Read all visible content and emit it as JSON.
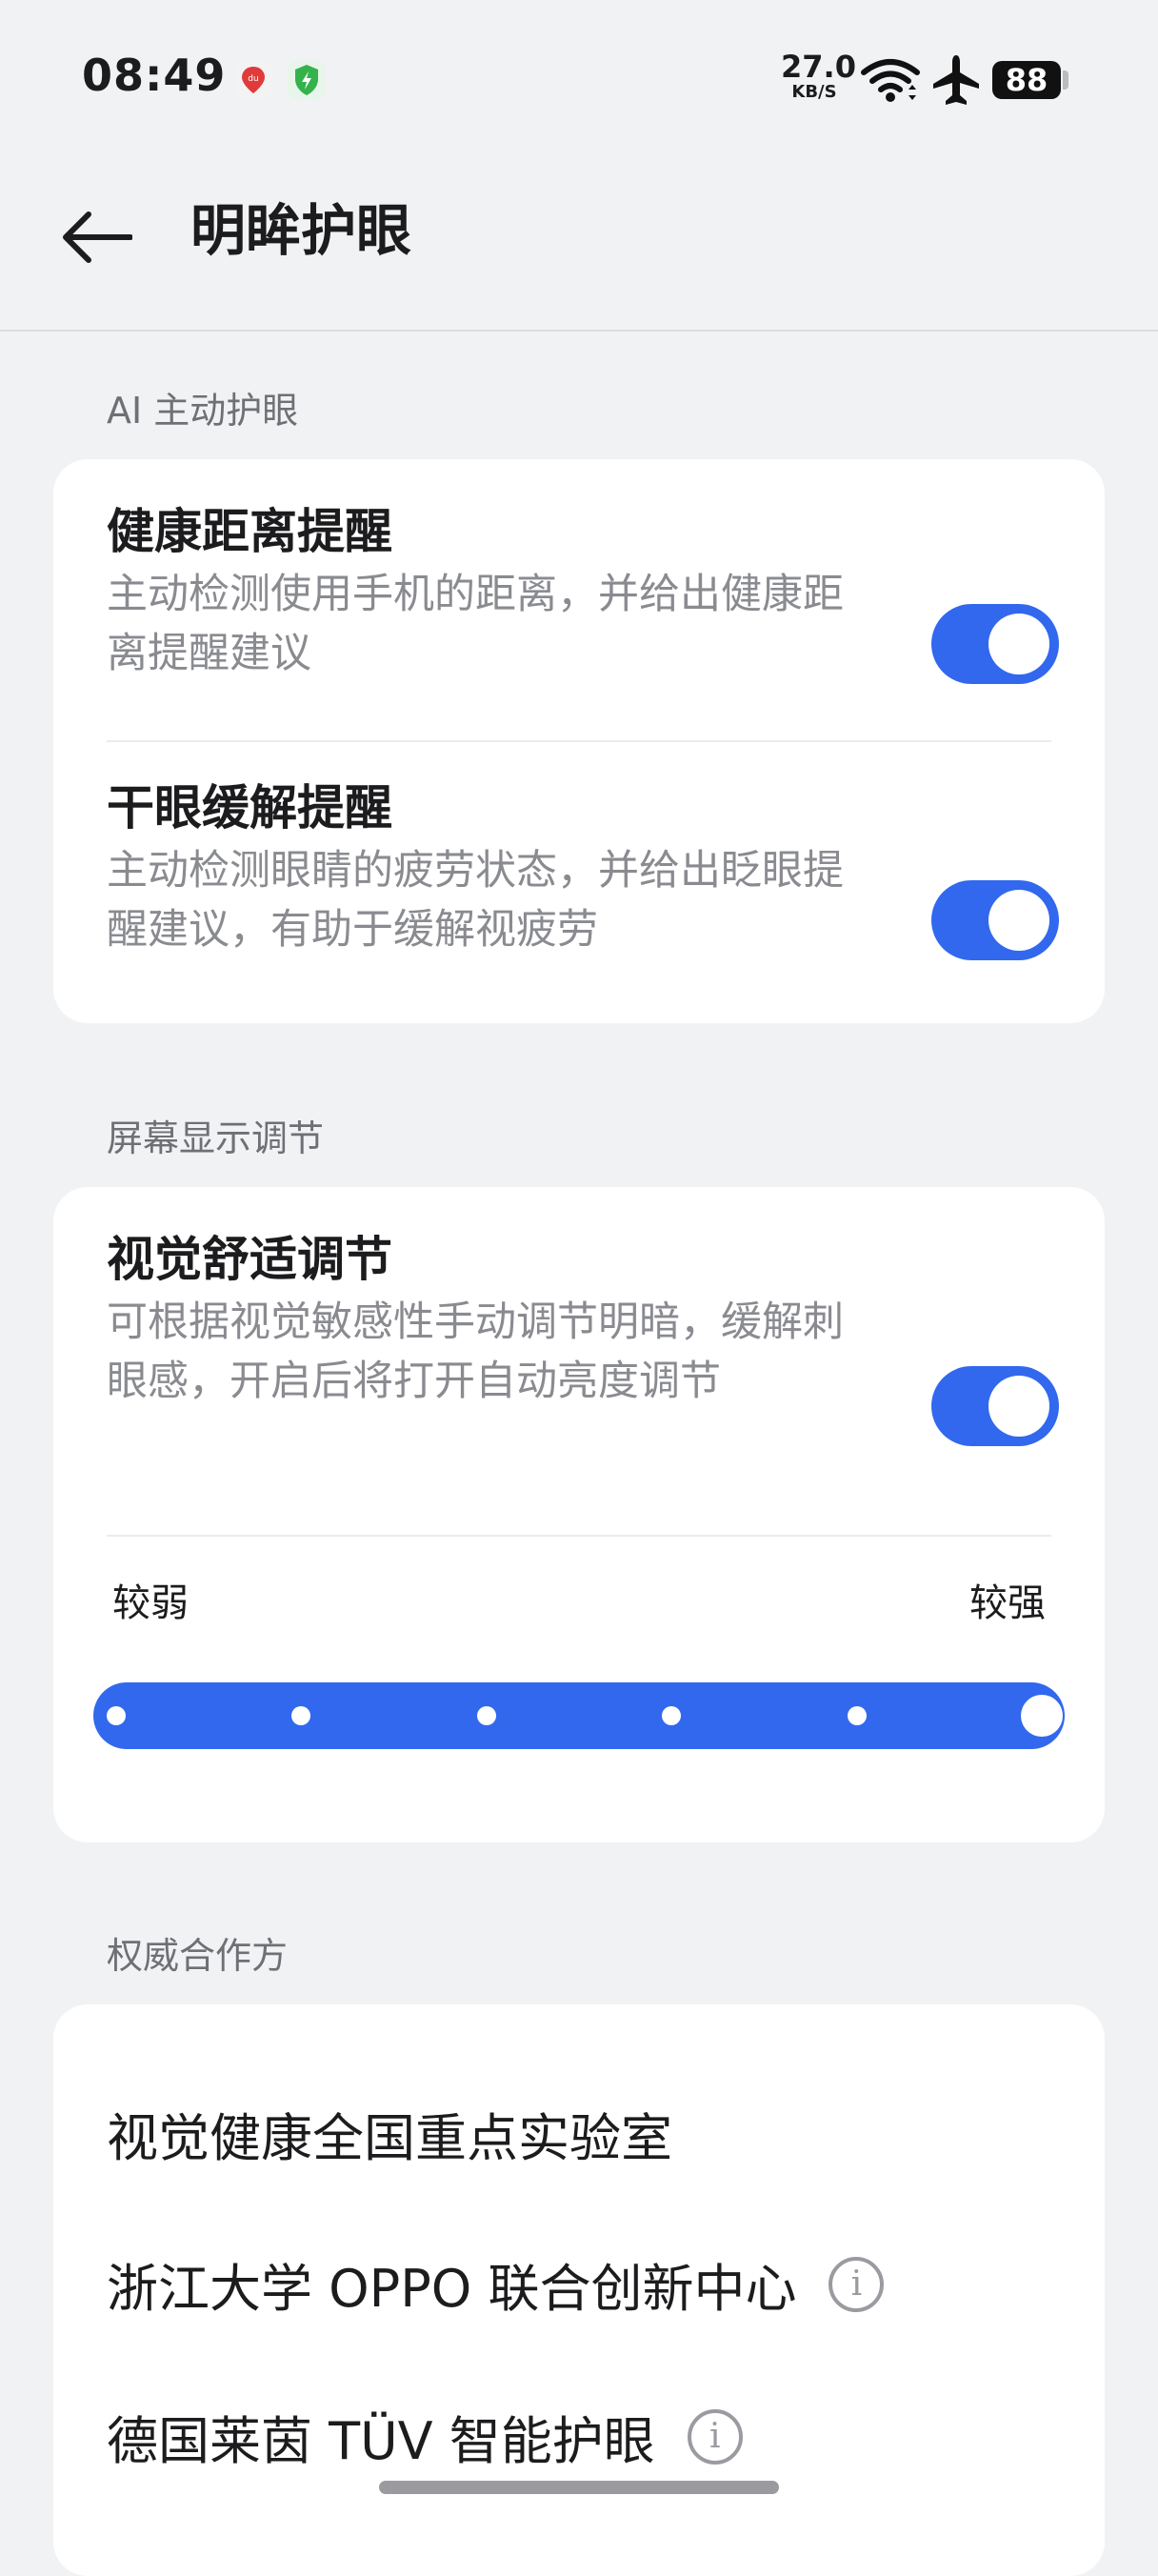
{
  "status_bar": {
    "time": "08:49",
    "net_speed_value": "27.0",
    "net_speed_unit": "KB/S",
    "battery": "88",
    "icons": [
      "baidu-maps-app-icon",
      "security-shield-icon",
      "wifi-icon",
      "airplane-icon",
      "battery-icon"
    ]
  },
  "header": {
    "title": "明眸护眼"
  },
  "sections": {
    "ai": {
      "label": "AI 主动护眼",
      "items": [
        {
          "title": "健康距离提醒",
          "desc": "主动检测使用手机的距离，并给出健康距离提醒建议",
          "enabled": true
        },
        {
          "title": "干眼缓解提醒",
          "desc": "主动检测眼睛的疲劳状态，并给出眨眼提醒建议，有助于缓解视疲劳",
          "enabled": true
        }
      ]
    },
    "display": {
      "label": "屏幕显示调节",
      "item": {
        "title": "视觉舒适调节",
        "desc": "可根据视觉敏感性手动调节明暗，缓解刺眼感，开启后将打开自动亮度调节",
        "enabled": true
      },
      "slider": {
        "min_label": "较弱",
        "max_label": "较强",
        "steps": 6,
        "selected_index": 5
      }
    },
    "partners": {
      "label": "权威合作方",
      "items": [
        {
          "name": "视觉健康全国重点实验室",
          "has_info": false
        },
        {
          "name": "浙江大学 OPPO 联合创新中心",
          "has_info": true
        },
        {
          "name": "德国莱茵 TÜV 智能护眼",
          "has_info": true
        }
      ]
    }
  },
  "colors": {
    "accent": "#3168ee",
    "background": "#f1f2f4",
    "card": "#ffffff"
  }
}
